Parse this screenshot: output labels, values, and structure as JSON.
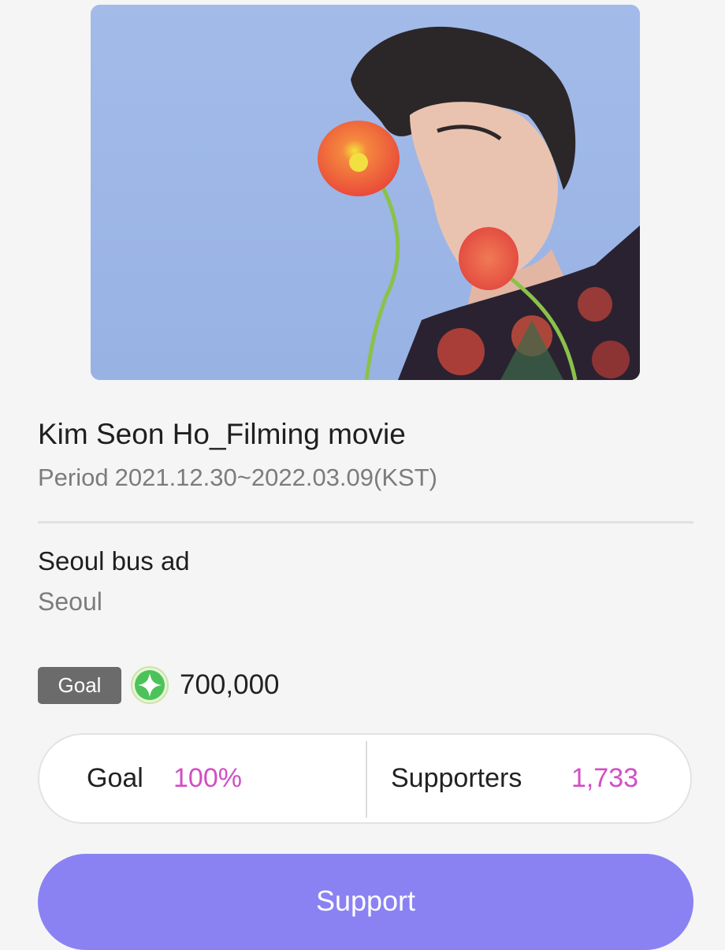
{
  "hero": {
    "image_description": "person-with-red-poppy-flowers"
  },
  "project": {
    "title": "Kim Seon Ho_Filming movie",
    "period_label": "Period",
    "period_value": "2021.12.30~2022.03.09(KST)",
    "ad_title": "Seoul bus ad",
    "location": "Seoul"
  },
  "goal": {
    "badge_label": "Goal",
    "gem_icon": "green-sparkle-gem-icon",
    "amount": "700,000"
  },
  "stats": {
    "goal_label": "Goal",
    "goal_value": "100%",
    "supporters_label": "Supporters",
    "supporters_value": "1,733"
  },
  "actions": {
    "support_label": "Support"
  },
  "colors": {
    "accent_purple": "#8a82f3",
    "stat_pink": "#d14fc4",
    "badge_gray": "#6b6b6b",
    "hero_sky": "#a7bde8"
  }
}
